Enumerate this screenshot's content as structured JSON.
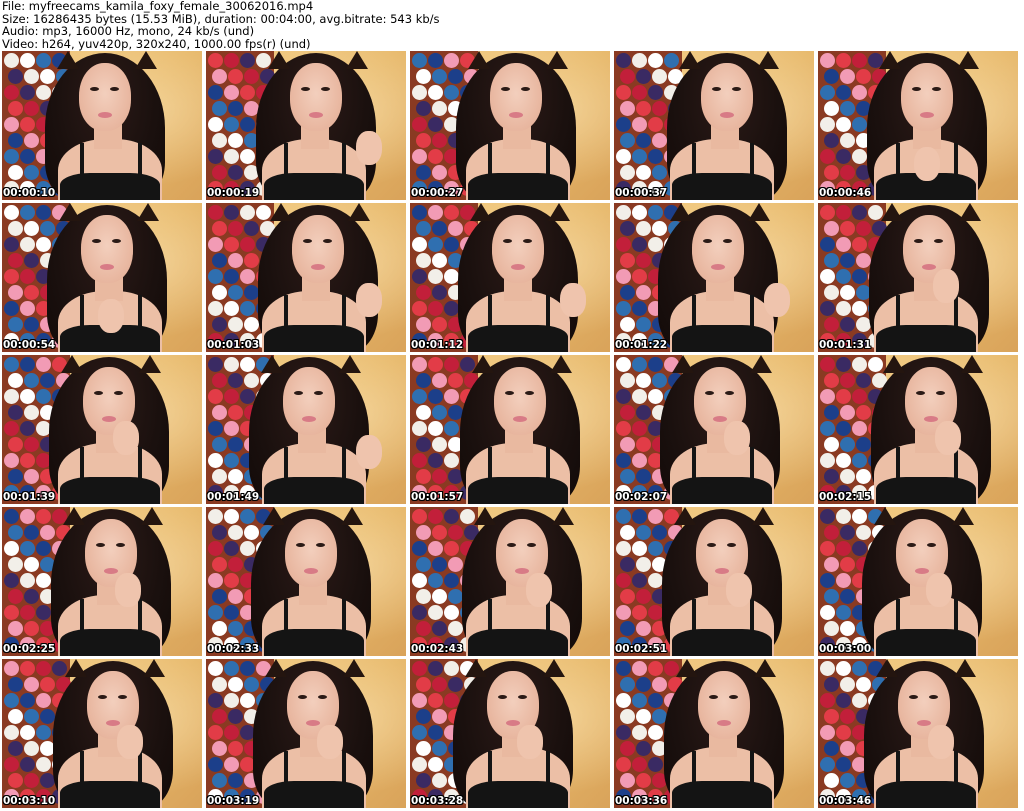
{
  "header": {
    "file_line": "File: myfreecams_kamila_foxy_female_30062016.mp4",
    "size_line": "Size: 16286435 bytes (15.53 MiB), duration: 00:04:00, avg.bitrate: 543 kb/s",
    "audio_line": "Audio: mp3, 16000 Hz, mono, 24 kb/s (und)",
    "video_line": "Video: h264, yuv420p, 320x240, 1000.00 fps(r) (und)"
  },
  "thumbnails": [
    {
      "timestamp": "00:00:10",
      "hand": "none"
    },
    {
      "timestamp": "00:00:19",
      "hand": "right"
    },
    {
      "timestamp": "00:00:27",
      "hand": "none"
    },
    {
      "timestamp": "00:00:37",
      "hand": "none"
    },
    {
      "timestamp": "00:00:46",
      "hand": "left"
    },
    {
      "timestamp": "00:00:54",
      "hand": "left"
    },
    {
      "timestamp": "00:01:03",
      "hand": "right"
    },
    {
      "timestamp": "00:01:12",
      "hand": "right"
    },
    {
      "timestamp": "00:01:22",
      "hand": "right"
    },
    {
      "timestamp": "00:01:31",
      "hand": "chin"
    },
    {
      "timestamp": "00:01:39",
      "hand": "chin"
    },
    {
      "timestamp": "00:01:49",
      "hand": "right"
    },
    {
      "timestamp": "00:01:57",
      "hand": "none"
    },
    {
      "timestamp": "00:02:07",
      "hand": "chin"
    },
    {
      "timestamp": "00:02:15",
      "hand": "chin"
    },
    {
      "timestamp": "00:02:25",
      "hand": "chin"
    },
    {
      "timestamp": "00:02:33",
      "hand": "none"
    },
    {
      "timestamp": "00:02:43",
      "hand": "chin"
    },
    {
      "timestamp": "00:02:51",
      "hand": "chin"
    },
    {
      "timestamp": "00:03:00",
      "hand": "chin"
    },
    {
      "timestamp": "00:03:10",
      "hand": "chin"
    },
    {
      "timestamp": "00:03:19",
      "hand": "chin"
    },
    {
      "timestamp": "00:03:28",
      "hand": "chin"
    },
    {
      "timestamp": "00:03:36",
      "hand": "none"
    },
    {
      "timestamp": "00:03:46",
      "hand": "chin"
    }
  ],
  "colors": {
    "page_background": "#ffffff",
    "header_text": "#000000",
    "timestamp_text": "#ffffff",
    "timestamp_outline": "#000000",
    "wall": "#e7b86a",
    "rack": "#8a3a22",
    "hair": "#1a100e",
    "skin": "#ecbfa6",
    "top": "#141414",
    "lips": "#d87b86",
    "pom_palette": [
      "#f2efe9",
      "#e23c47",
      "#2f6fb0",
      "#3a2a63",
      "#f29bb5",
      "#ffffff",
      "#c21f3a",
      "#1c3f8a"
    ]
  }
}
